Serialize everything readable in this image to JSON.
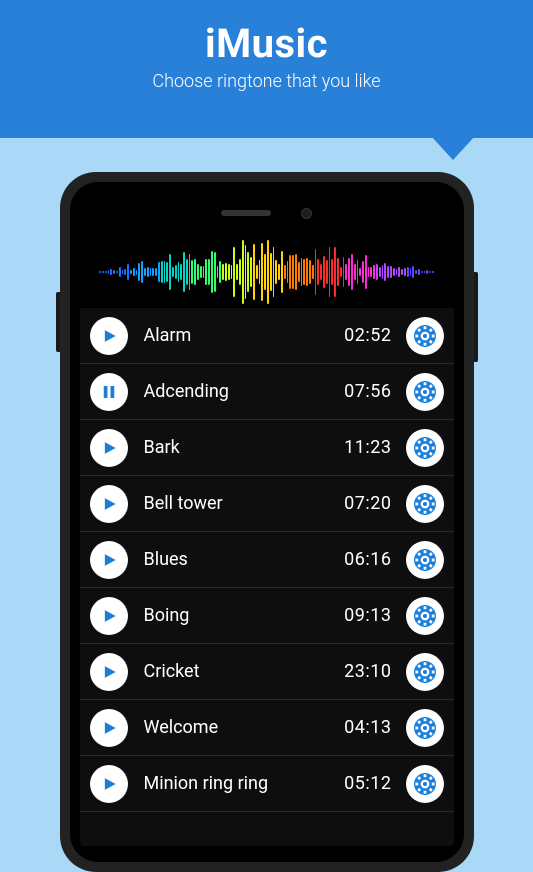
{
  "header": {
    "title": "iMusic",
    "subtitle": "Choose ringtone that you like"
  },
  "accent": "#1b7fd8",
  "ringtones": [
    {
      "name": "Alarm",
      "time": "02:52",
      "state": "play"
    },
    {
      "name": "Adcending",
      "time": "07:56",
      "state": "pause"
    },
    {
      "name": "Bark",
      "time": "11:23",
      "state": "play"
    },
    {
      "name": "Bell tower",
      "time": "07:20",
      "state": "play"
    },
    {
      "name": "Blues",
      "time": "06:16",
      "state": "play"
    },
    {
      "name": "Boing",
      "time": "09:13",
      "state": "play"
    },
    {
      "name": "Cricket",
      "time": "23:10",
      "state": "play"
    },
    {
      "name": "Welcome",
      "time": "04:13",
      "state": "play"
    },
    {
      "name": "Minion ring ring",
      "time": "05:12",
      "state": "play"
    }
  ]
}
